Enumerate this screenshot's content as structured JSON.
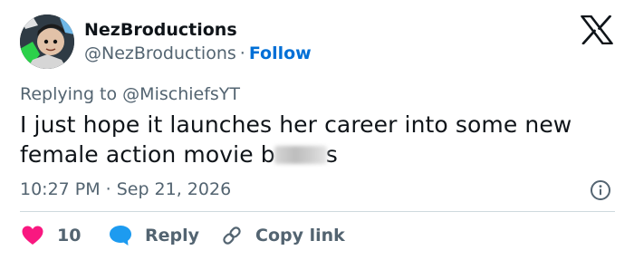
{
  "user": {
    "name": "NezBroductions",
    "handle": "@NezBroductions",
    "separator": "·",
    "follow_label": "Follow"
  },
  "reply_to": {
    "prefix": "Replying to",
    "handle": "@MischiefsYT"
  },
  "tweet": {
    "text_before": "I just hope it launches her career into some new female action movie b",
    "text_after": "s"
  },
  "meta": {
    "time": "10:27 PM",
    "separator": "·",
    "date": "Sep 21, 2026"
  },
  "actions": {
    "like_count": "10",
    "reply_label": "Reply",
    "copy_label": "Copy link"
  },
  "colors": {
    "like": "#f91880",
    "reply": "#1d9bf0",
    "follow": "#006fd6",
    "muted": "#536471"
  },
  "icons": {
    "logo": "x-logo-icon",
    "info": "info-icon",
    "like": "heart-icon",
    "reply": "speech-bubble-icon",
    "copy": "link-icon"
  }
}
